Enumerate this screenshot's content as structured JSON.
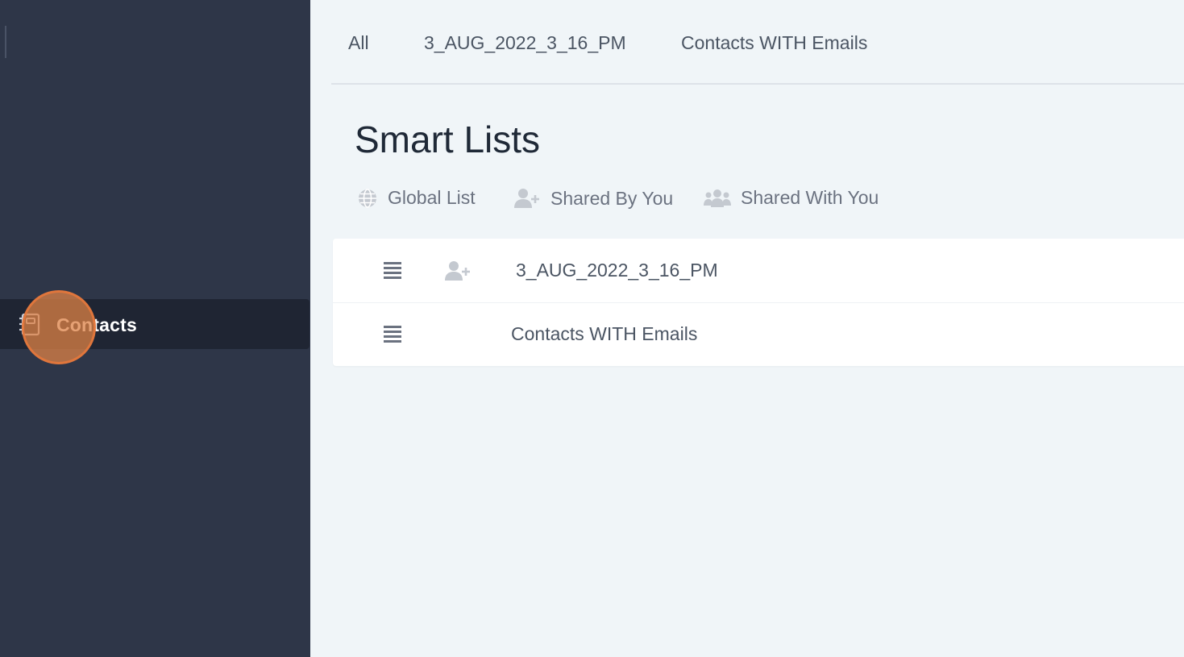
{
  "sidebar": {
    "active_item": {
      "label": "Contacts",
      "icon": "contacts-book-icon"
    }
  },
  "tabs": [
    {
      "label": "All"
    },
    {
      "label": "3_AUG_2022_3_16_PM"
    },
    {
      "label": "Contacts WITH Emails"
    }
  ],
  "page": {
    "title": "Smart Lists"
  },
  "filters": [
    {
      "label": "Global List",
      "icon": "globe-icon"
    },
    {
      "label": "Shared By You",
      "icon": "user-plus-icon"
    },
    {
      "label": "Shared With You",
      "icon": "users-icon"
    }
  ],
  "lists": [
    {
      "name": "3_AUG_2022_3_16_PM",
      "shared": true
    },
    {
      "name": "Contacts WITH Emails",
      "shared": false
    }
  ],
  "colors": {
    "sidebar_bg": "#2e3648",
    "sidebar_active_bg": "#1f2533",
    "main_bg": "#f0f5f8",
    "click_marker": "#de8246"
  }
}
